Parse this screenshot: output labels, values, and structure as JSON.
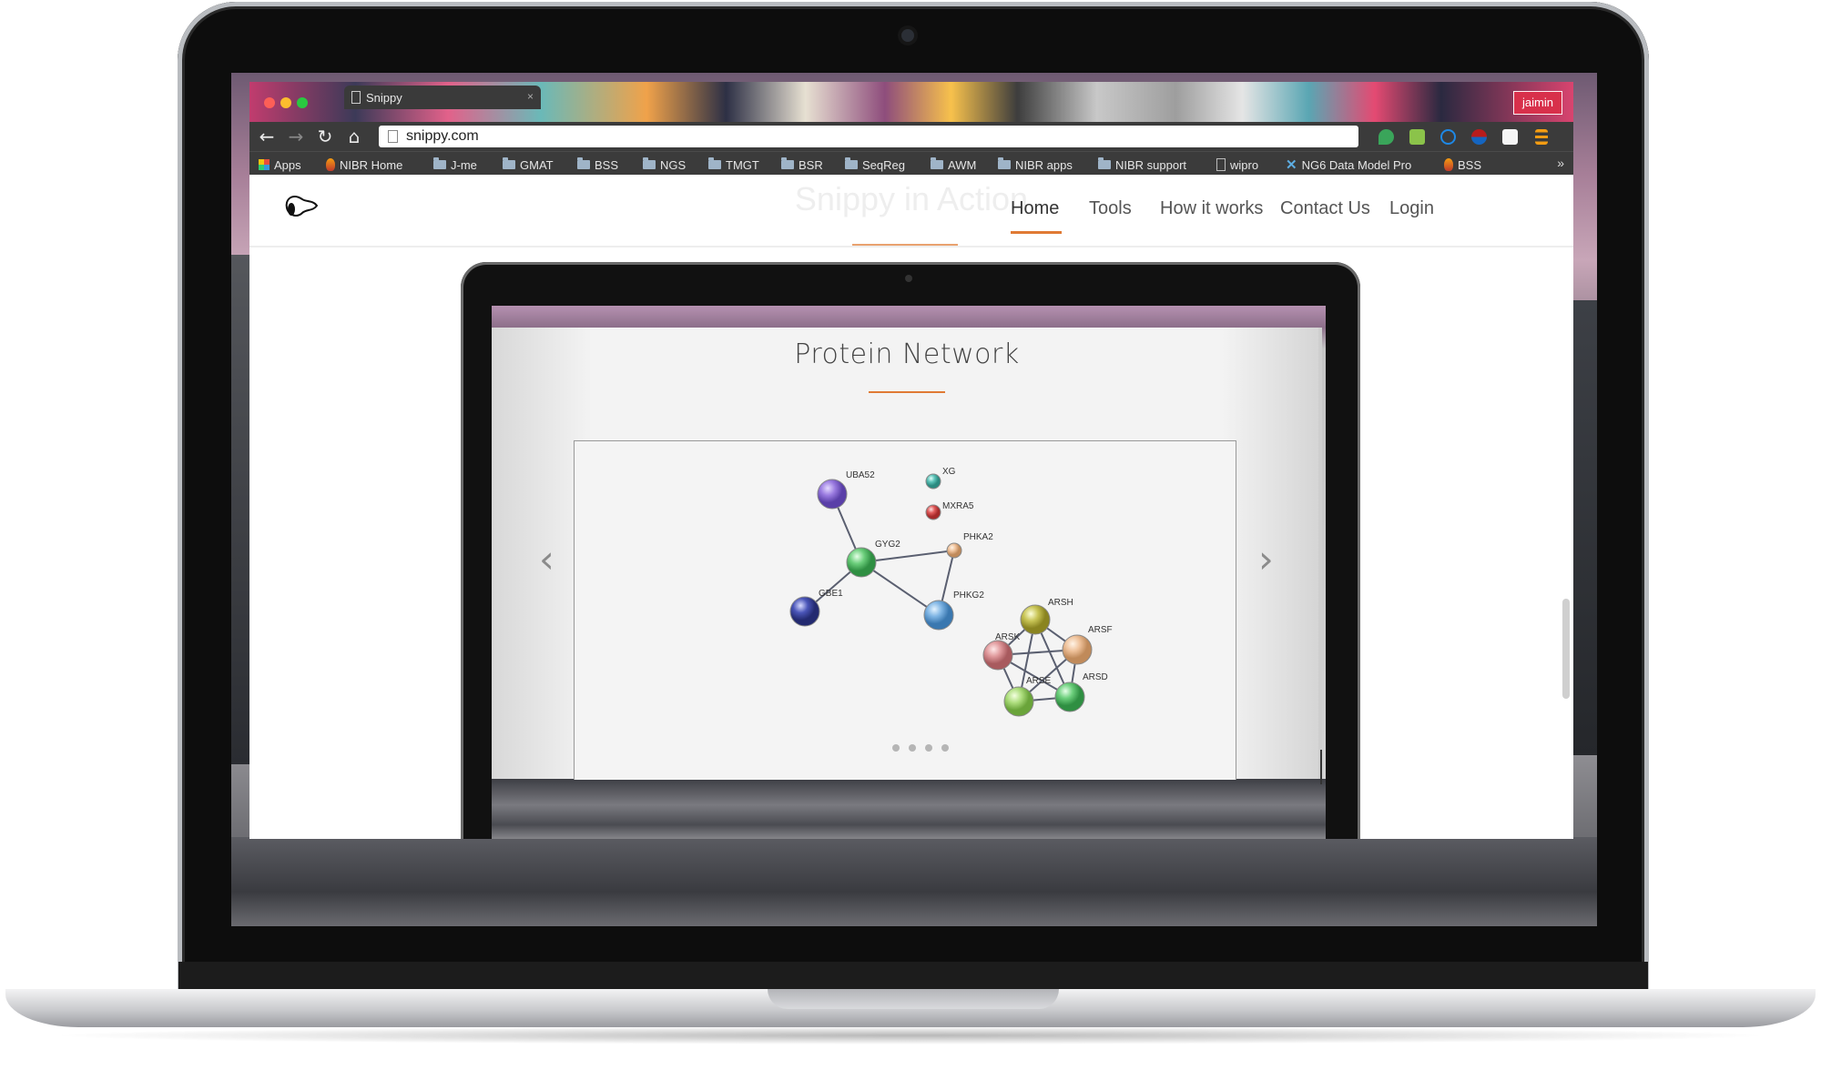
{
  "browser": {
    "tab_title": "Snippy",
    "tab_close": "×",
    "profile_name": "jaimin",
    "url": "snippy.com",
    "bookmarks": [
      "Apps",
      "NIBR Home",
      "J-me",
      "GMAT",
      "BSS",
      "NGS",
      "TMGT",
      "BSR",
      "SeqReg",
      "AWM",
      "NIBR apps",
      "NIBR support",
      "wipro",
      "NG6 Data Model Pro",
      "BSS"
    ],
    "bookmarks_more": "»",
    "nav_icons": [
      "back-icon",
      "forward-icon",
      "reload-icon",
      "home-icon"
    ]
  },
  "site": {
    "logo": "snippy-logo",
    "ghost_title": "Snippy in Action",
    "nav": [
      "Home",
      "Tools",
      "How it works",
      "Contact Us",
      "Login"
    ],
    "active_nav": "Home",
    "accent_color": "#e07a34"
  },
  "slide": {
    "title": "Protein Network",
    "prev_arrow": "‹",
    "next_arrow": "›",
    "dot_count": 4
  },
  "network": {
    "nodes": [
      "UBA52",
      "XG",
      "MXRA5",
      "GYG2",
      "PHKA2",
      "GBE1",
      "PHKG2",
      "ARSH",
      "ARSF",
      "ARSK",
      "ARSE",
      "ARSD"
    ],
    "edges": [
      [
        "UBA52",
        "GYG2"
      ],
      [
        "GYG2",
        "PHKA2"
      ],
      [
        "GYG2",
        "GBE1"
      ],
      [
        "GYG2",
        "PHKG2"
      ],
      [
        "PHKA2",
        "PHKG2"
      ],
      [
        "ARSH",
        "ARSF"
      ],
      [
        "ARSH",
        "ARSK"
      ],
      [
        "ARSH",
        "ARSE"
      ],
      [
        "ARSH",
        "ARSD"
      ],
      [
        "ARSF",
        "ARSK"
      ],
      [
        "ARSF",
        "ARSE"
      ],
      [
        "ARSF",
        "ARSD"
      ],
      [
        "ARSK",
        "ARSE"
      ],
      [
        "ARSK",
        "ARSD"
      ],
      [
        "ARSE",
        "ARSD"
      ]
    ]
  }
}
